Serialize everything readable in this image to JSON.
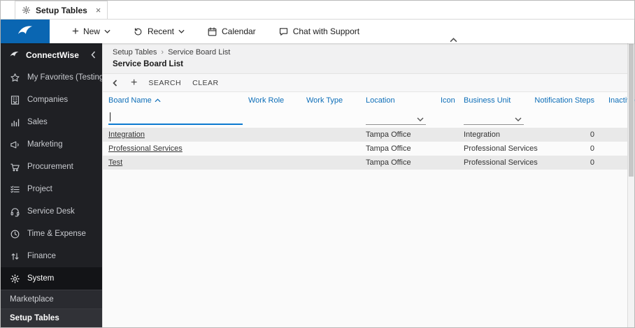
{
  "window": {
    "tab_label": "Setup Tables"
  },
  "icons": {
    "plus_glyph": "+",
    "close_glyph": "×",
    "breadcrumb_separator": "›"
  },
  "top_nav": {
    "new_label": "New",
    "recent_label": "Recent",
    "calendar_label": "Calendar",
    "chat_label": "Chat with Support"
  },
  "sidebar": {
    "brand_label": "ConnectWise",
    "items": [
      {
        "id": "favorites",
        "label": "My Favorites (Testing"
      },
      {
        "id": "companies",
        "label": "Companies"
      },
      {
        "id": "sales",
        "label": "Sales"
      },
      {
        "id": "marketing",
        "label": "Marketing"
      },
      {
        "id": "procurement",
        "label": "Procurement"
      },
      {
        "id": "project",
        "label": "Project"
      },
      {
        "id": "service-desk",
        "label": "Service Desk"
      },
      {
        "id": "time-expense",
        "label": "Time & Expense"
      },
      {
        "id": "finance",
        "label": "Finance"
      },
      {
        "id": "system",
        "label": "System"
      }
    ],
    "footer_items": [
      {
        "id": "marketplace",
        "label": "Marketplace"
      },
      {
        "id": "setup-tables",
        "label": "Setup Tables"
      }
    ]
  },
  "breadcrumb": {
    "parent": "Setup Tables",
    "current": "Service Board List"
  },
  "page": {
    "title": "Service Board List"
  },
  "toolbar": {
    "search_label": "SEARCH",
    "clear_label": "CLEAR"
  },
  "table": {
    "columns": [
      "Board Name",
      "Work Role",
      "Work Type",
      "Location",
      "Icon",
      "Business Unit",
      "Notification Steps",
      "Inactive"
    ],
    "sorted_by": "Board Name",
    "sort_direction": "asc",
    "filters": {
      "board_name_value": "",
      "location_value": "",
      "business_unit_value": ""
    },
    "rows": [
      {
        "board_name": "Integration",
        "work_role": "",
        "work_type": "",
        "location": "Tampa Office",
        "icon": "",
        "business_unit": "Integration",
        "notification_steps": "0",
        "inactive": ""
      },
      {
        "board_name": "Professional Services",
        "work_role": "",
        "work_type": "",
        "location": "Tampa Office",
        "icon": "",
        "business_unit": "Professional Services",
        "notification_steps": "0",
        "inactive": ""
      },
      {
        "board_name": "Test",
        "work_role": "",
        "work_type": "",
        "location": "Tampa Office",
        "icon": "",
        "business_unit": "Professional Services",
        "notification_steps": "0",
        "inactive": ""
      }
    ]
  },
  "colors": {
    "brand_blue": "#0a66b2",
    "header_link_blue": "#0d6eb8",
    "sidebar_bg": "#1f2024",
    "row_alt_gray": "#e9e9e9"
  }
}
